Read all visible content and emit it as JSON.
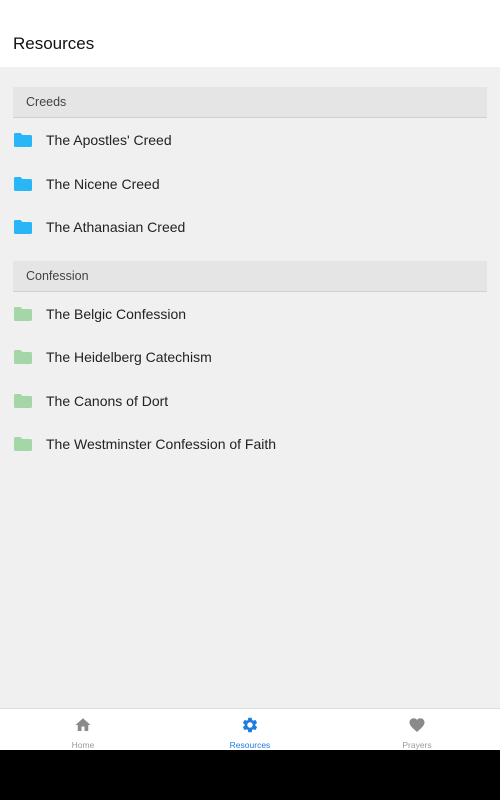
{
  "header": {
    "title": "Resources"
  },
  "sections": [
    {
      "title": "Creeds",
      "folder_color": "#29b6f6",
      "items": [
        {
          "label": "The Apostles' Creed",
          "icon": "folder-icon"
        },
        {
          "label": "The Nicene Creed",
          "icon": "folder-icon"
        },
        {
          "label": "The Athanasian Creed",
          "icon": "folder-icon"
        }
      ]
    },
    {
      "title": "Confession",
      "folder_color": "#a5d6a7",
      "items": [
        {
          "label": "The Belgic Confession",
          "icon": "folder-icon"
        },
        {
          "label": "The Heidelberg Catechism",
          "icon": "folder-icon"
        },
        {
          "label": "The Canons of Dort",
          "icon": "folder-icon"
        },
        {
          "label": "The Westminster Confession of Faith",
          "icon": "folder-icon"
        }
      ]
    }
  ],
  "tabs": [
    {
      "label": "Home",
      "icon": "home-icon",
      "active": false
    },
    {
      "label": "Resources",
      "icon": "gear-icon",
      "active": true
    },
    {
      "label": "Prayers",
      "icon": "heart-icon",
      "active": false
    }
  ],
  "colors": {
    "accent": "#1e7be0",
    "inactive_tab": "#8a8a8a",
    "background": "#f0f0f0"
  }
}
